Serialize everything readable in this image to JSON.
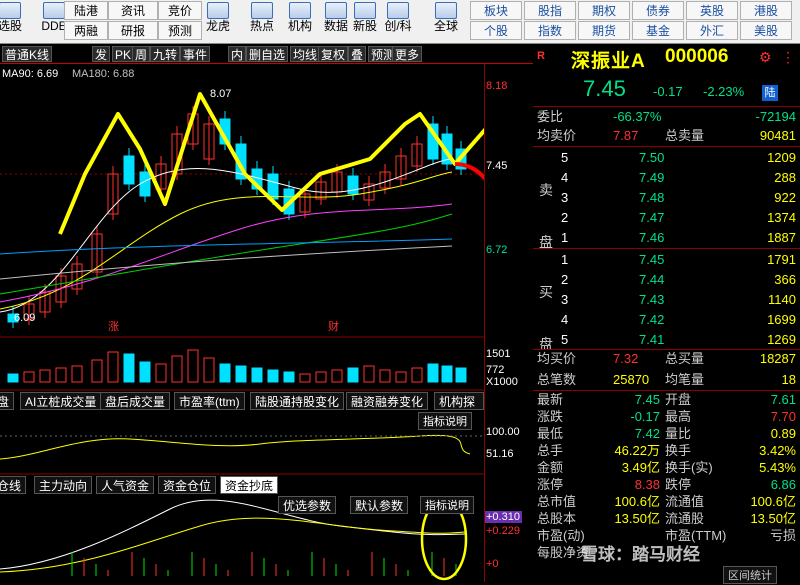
{
  "toolbar": {
    "left_buttons": [
      {
        "icon": "stock-icon",
        "label": "选股"
      },
      {
        "icon": "dde-icon",
        "label": "DDE"
      },
      {
        "icon": "dragon-tiger-icon",
        "label": "龙虎"
      },
      {
        "icon": "hot-icon",
        "label": "热点"
      },
      {
        "icon": "institution-icon",
        "label": "机构"
      },
      {
        "icon": "data-icon",
        "label": "数据"
      },
      {
        "icon": "new-stock-icon",
        "label": "新股"
      },
      {
        "icon": "chuang-icon",
        "label": "创/科"
      },
      {
        "icon": "globe-icon",
        "label": "全球"
      }
    ],
    "grid_a": [
      "陆港",
      "资讯",
      "竞价",
      "两融",
      "研报",
      "预测"
    ],
    "grid_b": [
      "板块",
      "股指",
      "期权",
      "债券",
      "英股",
      "港股",
      "个股",
      "指数",
      "期货",
      "基金",
      "外汇",
      "美股"
    ]
  },
  "chart": {
    "tabs": [
      "普通K线",
      "发",
      "PK",
      "周",
      "九转",
      "事件",
      "内",
      "删自选",
      "均线",
      "复权",
      "叠",
      "预测",
      "更多"
    ],
    "ma_legend": [
      {
        "text": "MA90: 6.69",
        "color": "#ffffff"
      },
      {
        "text": "MA180: 6.88",
        "color": "#c0c0c0"
      }
    ],
    "price_axis": [
      "8.18",
      "7.45",
      "6.72"
    ],
    "high_label": "8.07",
    "low_label": "6.09",
    "event_marks": [
      "涨",
      "财"
    ],
    "volume_axis": [
      "1501",
      "772",
      "X1000"
    ],
    "indicator_tabs": [
      "盘",
      "AI立桩成交量",
      "盘后成交量",
      "市盈率(ttm)",
      "陆股通持股变化",
      "融资融券变化",
      "机构探测器"
    ],
    "indicator_button": "指标说明",
    "indicator_axis": [
      "100.00",
      "51.16"
    ],
    "fund_tabs": [
      "仓线",
      "主力动向",
      "人气资金",
      "资金仓位",
      "资金抄底"
    ],
    "fund_buttons": [
      "优选参数",
      "默认参数",
      "指标说明"
    ],
    "fund_axis": [
      "+0.310",
      "+0.229",
      "+0"
    ]
  },
  "quote": {
    "name": "深振业A",
    "code": "000006",
    "price": "7.45",
    "change": "-0.17",
    "change_pct": "-2.23%",
    "exchange_badge": "陆",
    "weibi_label": "委比",
    "weibi_value": "-66.37%",
    "weicha_value": "-72194",
    "avg_sell_label": "均卖价",
    "avg_sell_value": "7.87",
    "total_sell_label": "总卖量",
    "total_sell_value": "90481",
    "sell_side": "卖盘",
    "buy_side": "买盘",
    "asks": [
      {
        "lvl": "5",
        "price": "7.50",
        "vol": "1209"
      },
      {
        "lvl": "4",
        "price": "7.49",
        "vol": "288"
      },
      {
        "lvl": "3",
        "price": "7.48",
        "vol": "922"
      },
      {
        "lvl": "2",
        "price": "7.47",
        "vol": "1374"
      },
      {
        "lvl": "1",
        "price": "7.46",
        "vol": "1887"
      }
    ],
    "bids": [
      {
        "lvl": "1",
        "price": "7.45",
        "vol": "1791"
      },
      {
        "lvl": "2",
        "price": "7.44",
        "vol": "366"
      },
      {
        "lvl": "3",
        "price": "7.43",
        "vol": "1140"
      },
      {
        "lvl": "4",
        "price": "7.42",
        "vol": "1699"
      },
      {
        "lvl": "5",
        "price": "7.41",
        "vol": "1269"
      }
    ],
    "avg_buy_label": "均买价",
    "avg_buy_value": "7.32",
    "total_buy_label": "总买量",
    "total_buy_value": "18287",
    "trades_label": "总笔数",
    "trades_value": "25870",
    "per_trade_label": "均笔量",
    "per_trade_value": "18",
    "stats": [
      [
        "最新",
        "7.45",
        "开盘",
        "7.61"
      ],
      [
        "涨跌",
        "-0.17",
        "最高",
        "7.70"
      ],
      [
        "最低",
        "7.42",
        "量比",
        "0.89"
      ],
      [
        "总手",
        "46.22万",
        "换手",
        "3.42%"
      ],
      [
        "金额",
        "3.49亿",
        "换手(实)",
        "5.43%"
      ],
      [
        "涨停",
        "8.38",
        "跌停",
        "6.86"
      ],
      [
        "总市值",
        "100.6亿",
        "流通值",
        "100.6亿"
      ],
      [
        "总股本",
        "13.50亿",
        "流通股",
        "13.50亿"
      ],
      [
        "市盈(动)",
        "",
        "市盈(TTM)",
        "亏损"
      ],
      [
        "每股净资",
        "",
        "",
        ""
      ]
    ],
    "footer_tab": "区间统计",
    "watermark": "雪球：踏马财经"
  },
  "colors": {
    "up": "#ff3030",
    "down": "#00e0ff",
    "flat": "#ffffff",
    "accent_yellow": "#ffff00"
  }
}
